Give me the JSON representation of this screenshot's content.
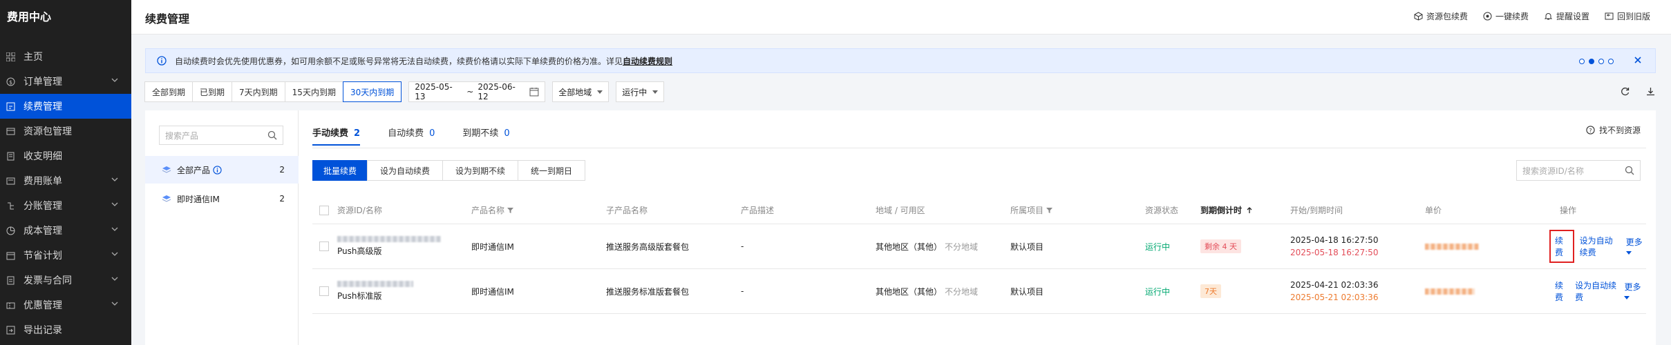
{
  "sidebar": {
    "brand": "费用中心",
    "items": [
      {
        "label": "主页",
        "icon": "grid-icon"
      },
      {
        "label": "订单管理",
        "icon": "order-icon",
        "expandable": true
      },
      {
        "label": "续费管理",
        "icon": "renew-icon",
        "active": true
      },
      {
        "label": "资源包管理",
        "icon": "package-icon"
      },
      {
        "label": "收支明细",
        "icon": "ledger-icon"
      },
      {
        "label": "费用账单",
        "icon": "bill-icon",
        "expandable": true
      },
      {
        "label": "分账管理",
        "icon": "split-icon",
        "expandable": true
      },
      {
        "label": "成本管理",
        "icon": "pie-icon",
        "expandable": true
      },
      {
        "label": "节省计划",
        "icon": "calendar-icon",
        "expandable": true
      },
      {
        "label": "发票与合同",
        "icon": "invoice-icon",
        "expandable": true
      },
      {
        "label": "优惠管理",
        "icon": "coupon-icon",
        "expandable": true
      },
      {
        "label": "导出记录",
        "icon": "export-icon"
      }
    ]
  },
  "header": {
    "title": "续费管理",
    "actions": [
      {
        "label": "资源包续费",
        "icon": "cube-icon"
      },
      {
        "label": "一键续费",
        "icon": "circle-renew-icon"
      },
      {
        "label": "提醒设置",
        "icon": "bell-icon"
      },
      {
        "label": "回到旧版",
        "icon": "back-icon"
      }
    ]
  },
  "notice": {
    "text": "自动续费时会优先使用优惠券，如可用余额不足或账号异常将无法自动续费，续费价格请以实际下单续费的价格为准。详见",
    "link": "自动续费规则",
    "pages": 4,
    "current_page": 2
  },
  "filters": {
    "periods": [
      "全部到期",
      "已到期",
      "7天内到期",
      "15天内到期",
      "30天内到期"
    ],
    "selected_period": "30天内到期",
    "date_start": "2025-05-13",
    "date_sep": "~",
    "date_end": "2025-06-12",
    "region": "全部地域",
    "status": "运行中"
  },
  "products": {
    "search_placeholder": "搜索产品",
    "items": [
      {
        "label": "全部产品",
        "count": "2",
        "active": true
      },
      {
        "label": "即时通信IM",
        "count": "2"
      }
    ]
  },
  "tabs": [
    {
      "label": "手动续费",
      "count": "2",
      "active": true
    },
    {
      "label": "自动续费",
      "count": "0"
    },
    {
      "label": "到期不续",
      "count": "0"
    }
  ],
  "cant_find": "找不到资源",
  "toolbar": {
    "batch_renew": "批量续费",
    "set_auto": "设为自动续费",
    "set_no_renew": "设为到期不续",
    "unify_date": "统一到期日"
  },
  "resource_search_placeholder": "搜索资源ID/名称",
  "table": {
    "columns": {
      "id": "资源ID/名称",
      "product": "产品名称",
      "sub_product": "子产品名称",
      "desc": "产品描述",
      "region": "地域 / 可用区",
      "project": "所属项目",
      "status": "资源状态",
      "countdown": "到期倒计时",
      "time": "开始/到期时间",
      "price": "单价",
      "ops": "操作"
    },
    "rows": [
      {
        "name": "Push高级版",
        "product": "即时通信IM",
        "sub_product": "推送服务高级版套餐包",
        "desc": "-",
        "region": "其他地区（其他）",
        "zone": "不分地域",
        "project": "默认项目",
        "status": "运行中",
        "countdown": "剩余 4 天",
        "start": "2025-04-18 16:27:50",
        "end": "2025-05-18 16:27:50",
        "op_renew": "续费",
        "op_auto": "设为自动续费",
        "op_more": "更多",
        "urgent": true
      },
      {
        "name": "Push标准版",
        "product": "即时通信IM",
        "sub_product": "推送服务标准版套餐包",
        "desc": "-",
        "region": "其他地区（其他）",
        "zone": "不分地域",
        "project": "默认项目",
        "status": "运行中",
        "countdown": "7天",
        "start": "2025-04-21 02:03:36",
        "end": "2025-05-21 02:03:36",
        "op_renew": "续费",
        "op_auto": "设为自动续费",
        "op_more": "更多",
        "urgent": false
      }
    ]
  },
  "colors": {
    "primary": "#0052d9",
    "sidebar_bg": "#202020",
    "danger": "#e34d59",
    "warning": "#ed7b2f",
    "success": "#00a870",
    "highlight_border": "#e02020"
  }
}
